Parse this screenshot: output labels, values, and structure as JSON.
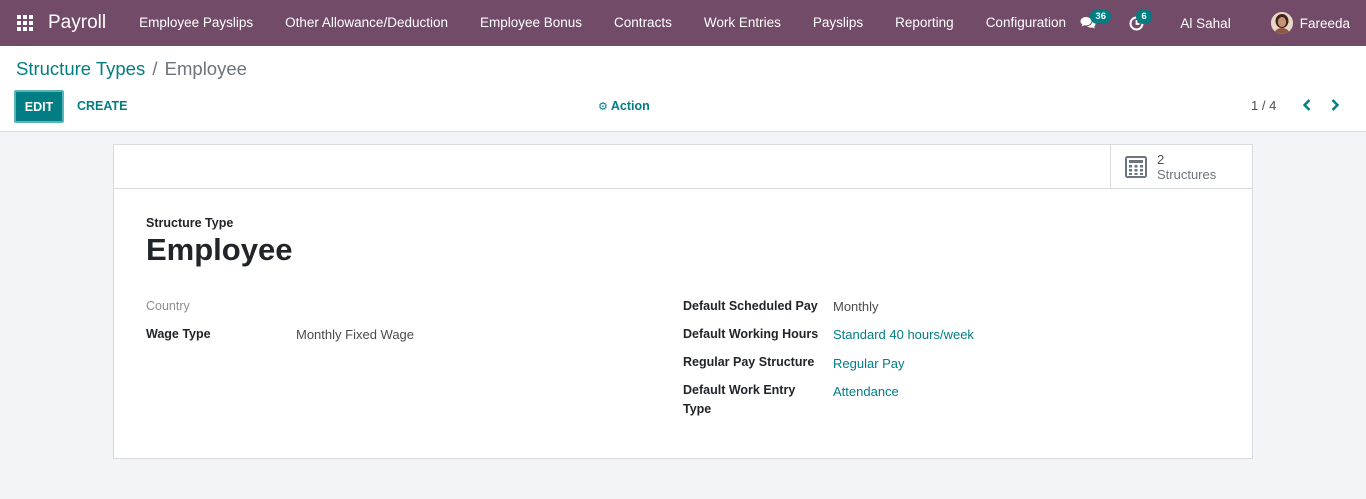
{
  "navbar": {
    "app_name": "Payroll",
    "menu": [
      "Employee Payslips",
      "Other Allowance/Deduction",
      "Employee Bonus",
      "Contracts",
      "Work Entries",
      "Payslips",
      "Reporting",
      "Configuration"
    ],
    "messages_count": "36",
    "activities_count": "6",
    "company": "Al Sahal",
    "user_name": "Fareeda",
    "color": "#714b67"
  },
  "breadcrumb": {
    "parent": "Structure Types",
    "separator": "/",
    "current": "Employee"
  },
  "control_panel": {
    "edit_label": "EDIT",
    "create_label": "CREATE",
    "action_label": "Action",
    "pager_value": "1 / 4"
  },
  "smart_button": {
    "value": "2",
    "label": "Structures",
    "icon": "calculator-icon"
  },
  "form": {
    "title_label": "Structure Type",
    "title_value": "Employee",
    "left_fields": {
      "country_label": "Country",
      "country_value": "",
      "wage_type_label": "Wage Type",
      "wage_type_value": "Monthly Fixed Wage"
    },
    "right_fields": {
      "default_scheduled_pay_label": "Default Scheduled Pay",
      "default_scheduled_pay_value": "Monthly",
      "default_working_hours_label": "Default Working Hours",
      "default_working_hours_value": "Standard 40 hours/week",
      "regular_pay_structure_label": "Regular Pay Structure",
      "regular_pay_structure_value": "Regular Pay",
      "default_work_entry_type_label_line1": "Default Work Entry",
      "default_work_entry_type_label_line2": "Type",
      "default_work_entry_type_value": "Attendance"
    }
  },
  "colors": {
    "accent": "#017e84",
    "navbar": "#714b67"
  }
}
